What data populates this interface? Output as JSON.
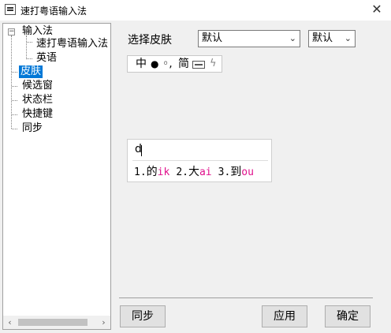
{
  "window": {
    "title": "速打粤语输入法",
    "close_glyph": "✕"
  },
  "tree": {
    "root": {
      "label": "输入法",
      "expander": "−"
    },
    "children": [
      {
        "label": "速打粤语输入法"
      },
      {
        "label": "英语"
      }
    ],
    "items": [
      {
        "label": "皮肤",
        "selected": true
      },
      {
        "label": "候选窗"
      },
      {
        "label": "状态栏"
      },
      {
        "label": "快捷键"
      },
      {
        "label": "同步"
      }
    ],
    "scroll_left": "‹",
    "scroll_right": "›"
  },
  "skin": {
    "label": "选择皮肤",
    "theme_value": "默认",
    "variant_value": "默认",
    "chevron": "⌄"
  },
  "status_preview": {
    "zh": "中",
    "fullwidth": "●",
    "punct": "◦,",
    "simp": "简",
    "bolt": "ϟ"
  },
  "candidate_preview": {
    "input": "d",
    "candidates": [
      {
        "num": "1.",
        "char": "的",
        "code": "ik"
      },
      {
        "num": "2.",
        "char": "大",
        "code": "ai"
      },
      {
        "num": "3.",
        "char": "到",
        "code": "ou"
      }
    ]
  },
  "buttons": {
    "sync": "同步",
    "apply": "应用",
    "ok": "确定"
  },
  "colors": {
    "selection": "#0078d7",
    "code_accent": "#e0108c"
  }
}
